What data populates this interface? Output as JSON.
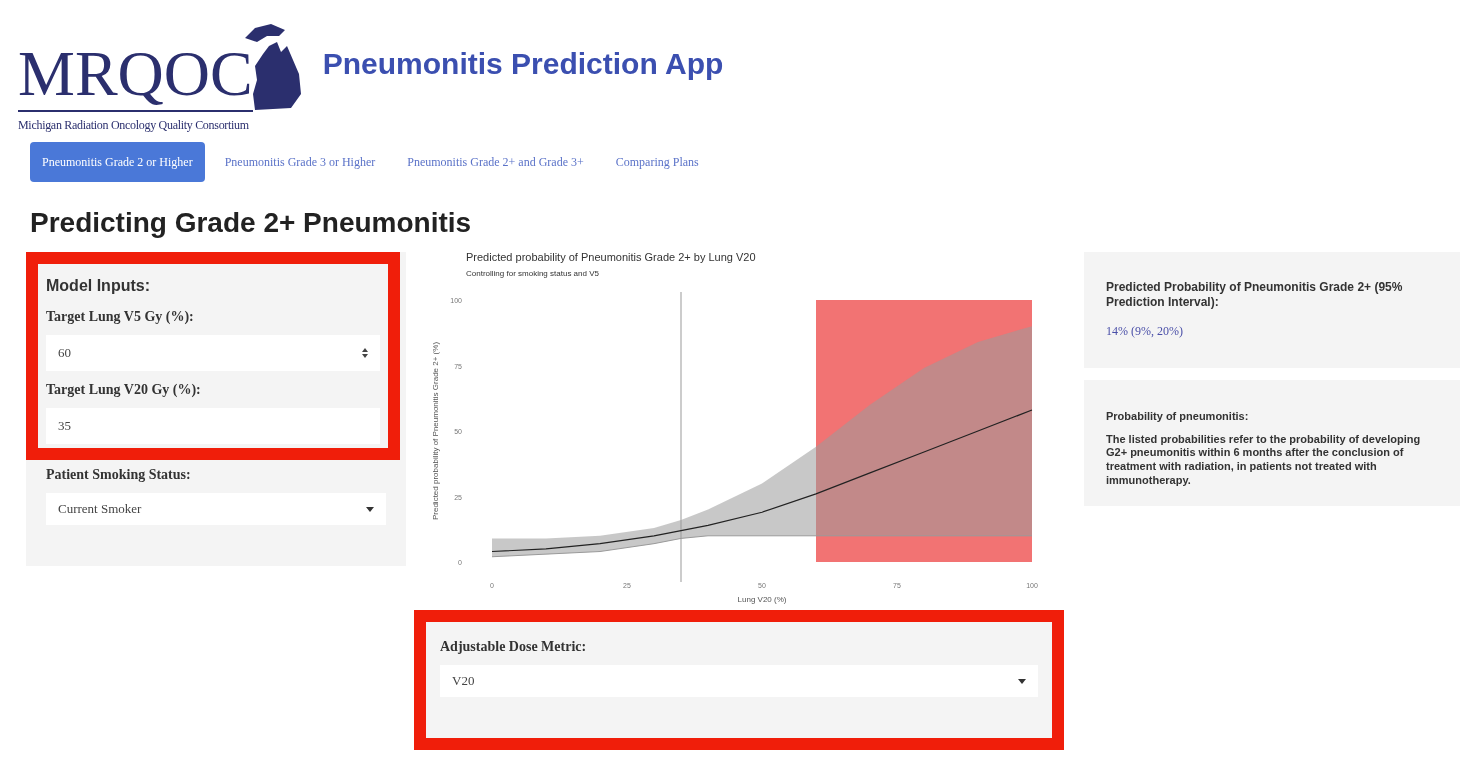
{
  "header": {
    "logo_text": "MRQOC",
    "logo_caption": "Michigan Radiation Oncology Quality Consortium",
    "app_title": "Pneumonitis Prediction App"
  },
  "tabs": [
    {
      "label": "Pneumonitis Grade 2 or Higher",
      "selected": true
    },
    {
      "label": "Pneumonitis Grade 3 or Higher",
      "selected": false
    },
    {
      "label": "Pneumonitis Grade 2+ and Grade 3+",
      "selected": false
    },
    {
      "label": "Comparing Plans",
      "selected": false
    }
  ],
  "page_heading": "Predicting Grade 2+ Pneumonitis",
  "inputs": {
    "highlighted": true,
    "title": "Model Inputs:",
    "fields": [
      {
        "label": "Target Lung V5 Gy (%):",
        "value": "60",
        "kind": "number"
      },
      {
        "label": "Target Lung V20 Gy (%):",
        "value": "35",
        "kind": "text"
      }
    ],
    "smoking": {
      "label": "Patient Smoking Status:",
      "value": "Current Smoker"
    }
  },
  "chart": {
    "chart_data": {
      "type": "line",
      "title": "Predicted probability of Pneumonitis Grade 2+ by Lung V20",
      "subtitle": "Controlling for smoking status and V5",
      "xlabel": "Lung V20 (%)",
      "ylabel": "Predicted probability of Pneumonitis Grade 2+ (%)",
      "x": [
        0,
        10,
        20,
        30,
        35,
        40,
        50,
        60,
        70,
        80,
        90,
        100
      ],
      "series": [
        {
          "color": "#222222",
          "values": [
            4,
            5,
            7,
            10,
            12,
            14,
            19,
            26,
            34,
            42,
            50,
            58
          ]
        },
        {
          "type": "line",
          "color": "#9a9a9a",
          "values": [
            2,
            3,
            4,
            7,
            9,
            10,
            10,
            10,
            10,
            10,
            10,
            10
          ]
        },
        {
          "type": "area",
          "color": "#9a9a9a",
          "values": [
            9,
            9,
            10,
            13,
            16,
            20,
            30,
            44,
            60,
            74,
            84,
            90
          ]
        }
      ],
      "xlim": [
        0,
        100
      ],
      "ylim": [
        0,
        100
      ],
      "xticks": [
        0,
        25,
        50,
        75,
        100
      ],
      "yticks": [
        0,
        25,
        50,
        75,
        100
      ],
      "ref_lines": [
        {
          "axis": "x",
          "value": 35,
          "color": "#999999"
        }
      ],
      "bands": [
        {
          "axis": "x",
          "from": 60,
          "to": 100,
          "color": "#f05a5a"
        }
      ]
    }
  },
  "dose_metric": {
    "highlighted": true,
    "label": "Adjustable Dose Metric:",
    "value": "V20"
  },
  "result": {
    "title": "Predicted Probability of Pneumonitis Grade 2+ (95% Prediction Interval):",
    "value": "14% (9%, 20%)"
  },
  "info": {
    "title": "Probability of pneumonitis:",
    "text": "The listed probabilities refer to the probability of developing G2+ pneumonitis within 6 months after the conclusion of treatment with radiation, in patients not treated with immunotherapy."
  }
}
